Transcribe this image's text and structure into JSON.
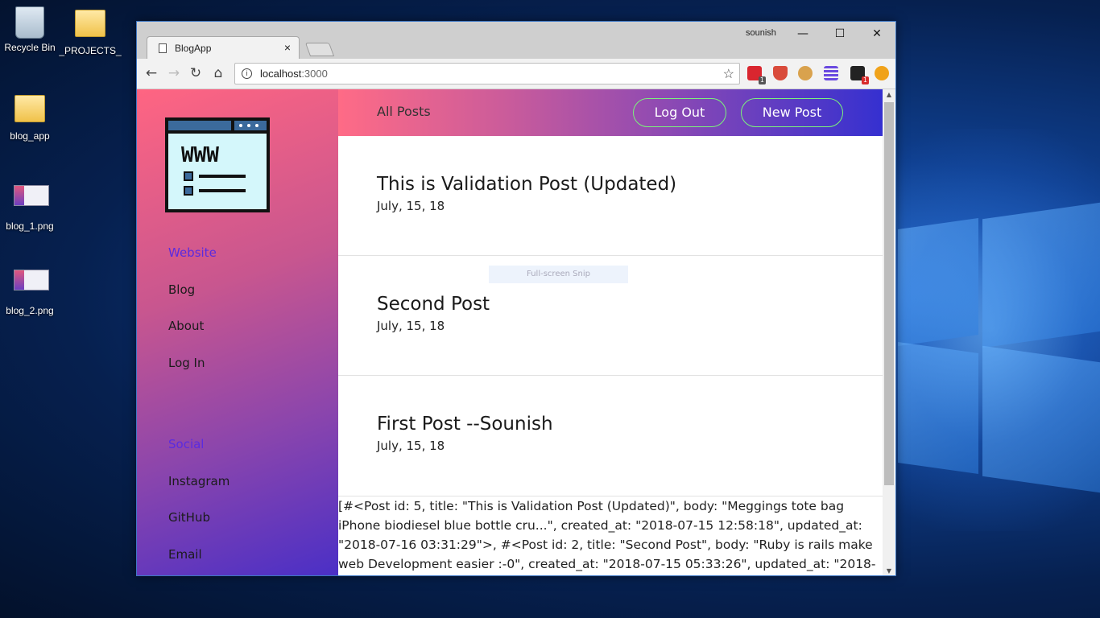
{
  "desktop": {
    "icons": [
      {
        "label": "Recycle Bin"
      },
      {
        "label": "_PROJECTS_"
      },
      {
        "label": "blog_app"
      },
      {
        "label": "blog_1.png"
      },
      {
        "label": "blog_2.png"
      }
    ]
  },
  "browser": {
    "tab_title": "BlogApp",
    "tab_close": "×",
    "profile_name": "sounish",
    "window_controls": {
      "minimize": "—",
      "maximize": "☐",
      "close": "✕"
    },
    "nav": {
      "back": "←",
      "forward": "→",
      "reload": "↻",
      "home": "⌂"
    },
    "url_host": "localhost",
    "url_port": ":3000",
    "star": "☆",
    "extension_badges": [
      "1",
      "1"
    ]
  },
  "sidebar": {
    "website_heading": "Website",
    "links": [
      "Blog",
      "About",
      "Log In"
    ],
    "social_heading": "Social",
    "social_links": [
      "Instagram",
      "GitHub",
      "Email"
    ],
    "logo_text": "WWW"
  },
  "topbar": {
    "all_posts": "All Posts",
    "logout": "Log Out",
    "new_post": "New Post"
  },
  "posts": [
    {
      "title": "This is Validation Post (Updated)",
      "date": "July, 15, 18"
    },
    {
      "title": "Second Post",
      "date": "July, 15, 18"
    },
    {
      "title": "First Post --Sounish",
      "date": "July, 15, 18"
    }
  ],
  "snip_overlay": "Full-screen Snip",
  "debug_dump": "[#<Post id: 5, title: \"This is Validation Post (Updated)\", body: \"Meggings tote bag iPhone biodiesel blue bottle cru...\", created_at: \"2018-07-15 12:58:18\", updated_at: \"2018-07-16 03:31:29\">, #<Post id: 2, title: \"Second Post\", body: \"Ruby is rails make web Development easier :-0\", created_at: \"2018-07-15 05:33:26\", updated_at: \"2018-",
  "colors": {
    "sidebar_top": "#ff6582",
    "sidebar_bottom": "#4a2fc6",
    "pill_border": "#7cf37c",
    "heading_accent": "#5a2be0"
  }
}
